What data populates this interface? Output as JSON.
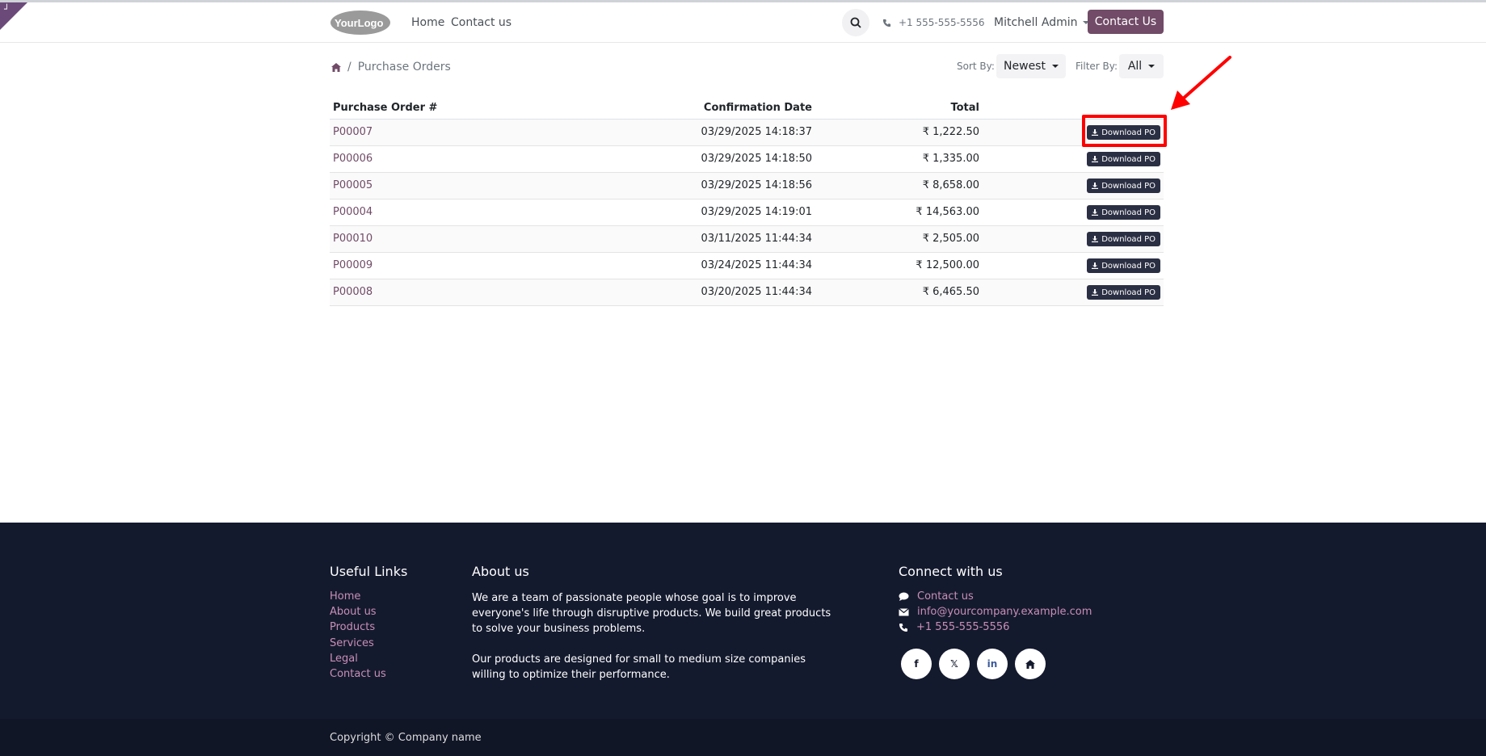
{
  "header": {
    "logo_text": "YourLogo",
    "nav": [
      "Home",
      "Contact us"
    ],
    "phone": "+1 555-555-5556",
    "user": "Mitchell Admin",
    "cta": "Contact Us"
  },
  "breadcrumb": {
    "current": "Purchase Orders"
  },
  "controls": {
    "sort_label": "Sort By:",
    "sort_value": "Newest",
    "filter_label": "Filter By:",
    "filter_value": "All"
  },
  "table": {
    "headers": {
      "order": "Purchase Order #",
      "date": "Confirmation Date",
      "total": "Total"
    },
    "download_label": "Download PO",
    "rows": [
      {
        "order": "P00007",
        "date": "03/29/2025  14:18:37",
        "total": "₹ 1,222.50"
      },
      {
        "order": "P00006",
        "date": "03/29/2025  14:18:50",
        "total": "₹ 1,335.00"
      },
      {
        "order": "P00005",
        "date": "03/29/2025  14:18:56",
        "total": "₹ 8,658.00"
      },
      {
        "order": "P00004",
        "date": "03/29/2025  14:19:01",
        "total": "₹ 14,563.00"
      },
      {
        "order": "P00010",
        "date": "03/11/2025  11:44:34",
        "total": "₹ 2,505.00"
      },
      {
        "order": "P00009",
        "date": "03/24/2025  11:44:34",
        "total": "₹ 12,500.00"
      },
      {
        "order": "P00008",
        "date": "03/20/2025  11:44:34",
        "total": "₹ 6,465.50"
      }
    ]
  },
  "footer": {
    "useful_links_title": "Useful Links",
    "useful_links": [
      "Home",
      "About us",
      "Products",
      "Services",
      "Legal",
      "Contact us"
    ],
    "about_title": "About us",
    "about_p1_lines": [
      "We are a team of passionate people whose goal is to improve",
      "everyone's life through disruptive products. We build great products",
      "to solve your business problems."
    ],
    "about_p2_lines": [
      "Our products are designed for small to medium size companies",
      "willing to optimize their performance."
    ],
    "connect_title": "Connect with us",
    "contact_us": "Contact us",
    "email": "info@yourcompany.example.com",
    "phone": "+1 555-555-5556",
    "social": [
      "facebook-icon",
      "x-icon",
      "linkedin-icon",
      "home-icon"
    ],
    "copyright": "Copyright © Company name"
  },
  "colors": {
    "brand": "#714b67",
    "footer_bg": "#141a2e",
    "highlight": "#ff0000"
  }
}
